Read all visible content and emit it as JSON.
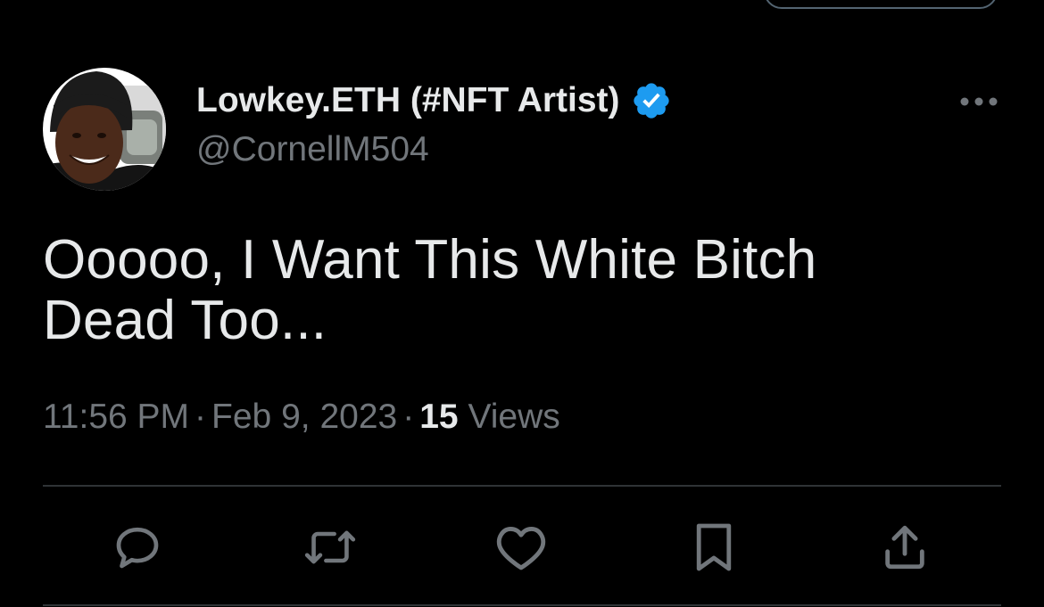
{
  "author": {
    "display_name": "Lowkey.ETH (#NFT Artist)",
    "handle": "@CornellM504",
    "verified": true
  },
  "tweet": {
    "text_line1": "Ooooo, I Want This White Bitch",
    "text_line2": "Dead Too...",
    "time": "11:56 PM",
    "date": "Feb 9, 2023",
    "views_count": "15",
    "views_label": "Views",
    "separator": "·"
  },
  "icons": {
    "verified": "verified-badge-icon",
    "more": "more-horizontal-icon",
    "reply": "reply-icon",
    "retweet": "retweet-icon",
    "like": "heart-icon",
    "bookmark": "bookmark-icon",
    "share": "share-icon"
  },
  "colors": {
    "background": "#000000",
    "primary_text": "#e7e9ea",
    "secondary_text": "#71767b",
    "verified_blue": "#1d9bf0",
    "divider": "#2f3336"
  }
}
